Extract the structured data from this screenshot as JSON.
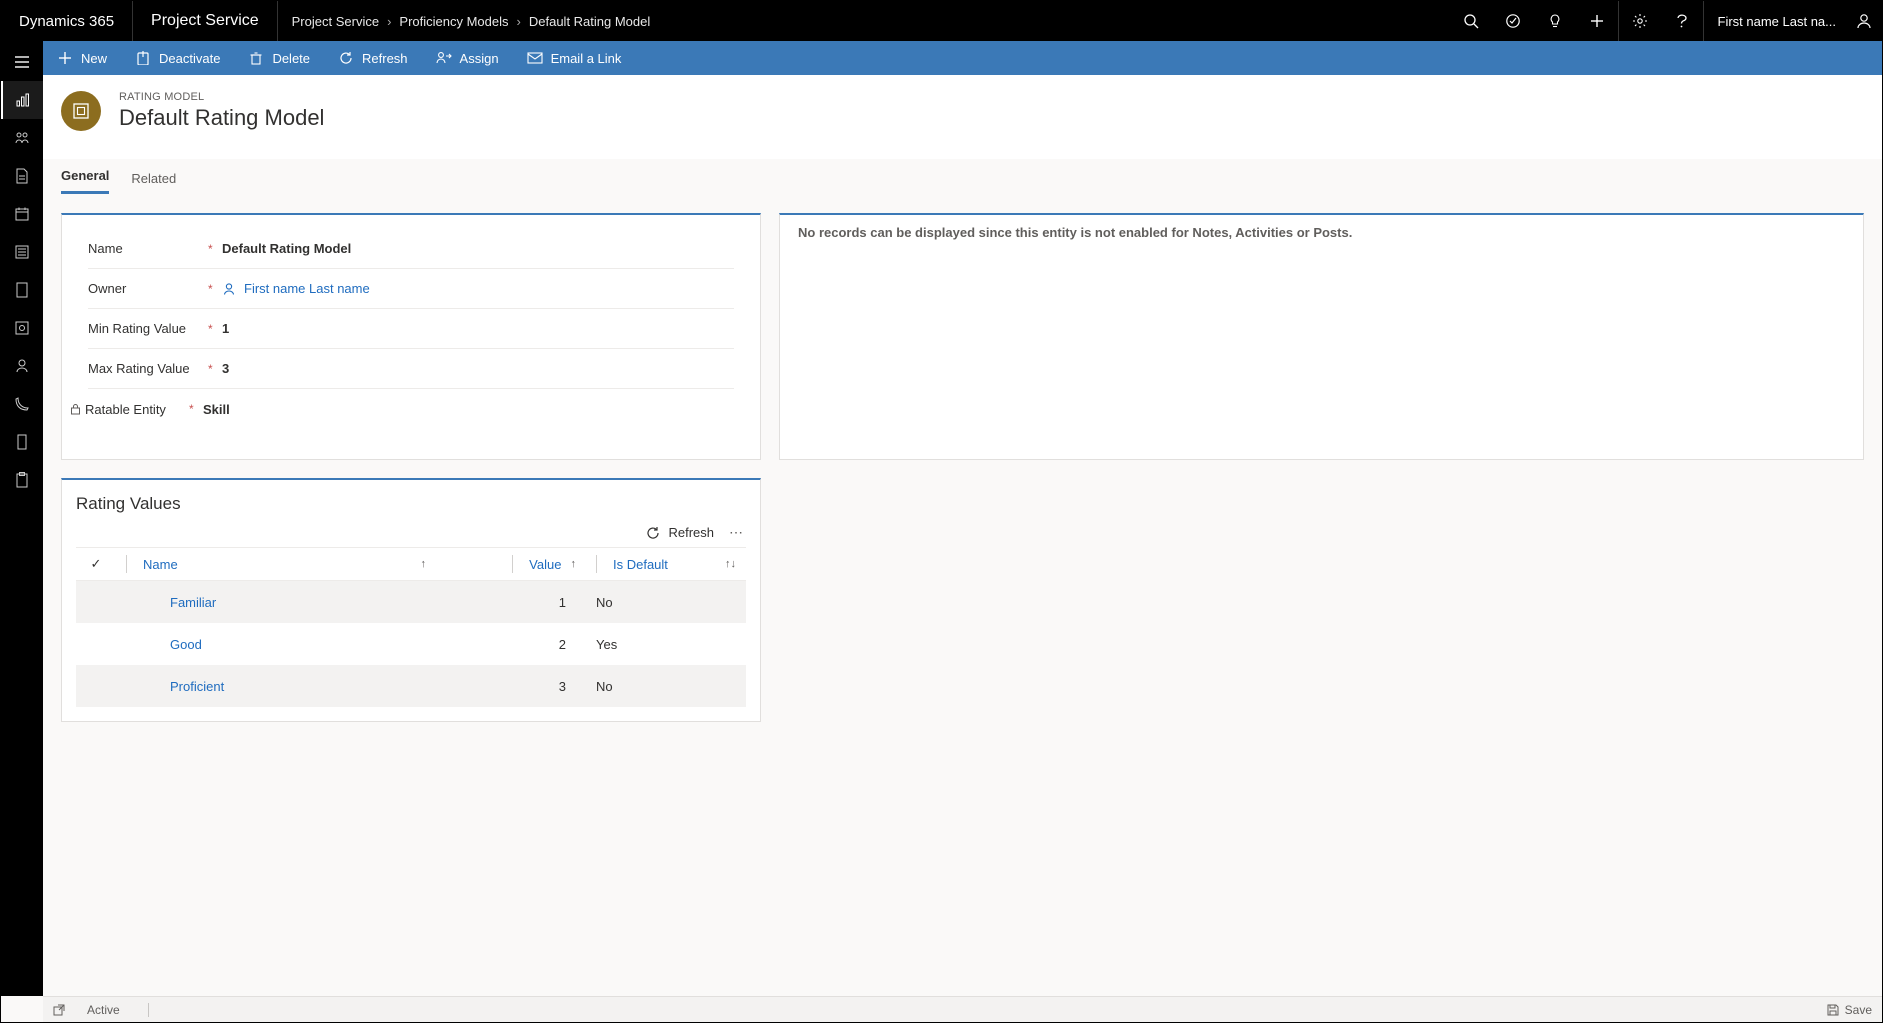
{
  "brand": "Dynamics 365",
  "product": "Project Service",
  "breadcrumb": [
    "Project Service",
    "Proficiency Models",
    "Default Rating Model"
  ],
  "user_display": "First name Last na...",
  "cmdbar": {
    "new": "New",
    "deactivate": "Deactivate",
    "delete": "Delete",
    "refresh": "Refresh",
    "assign": "Assign",
    "email": "Email a Link"
  },
  "record": {
    "entity_type": "RATING MODEL",
    "title": "Default Rating Model"
  },
  "tabs": {
    "general": "General",
    "related": "Related"
  },
  "form": {
    "labels": {
      "name": "Name",
      "owner": "Owner",
      "min": "Min Rating Value",
      "max": "Max Rating Value",
      "ratable": "Ratable Entity"
    },
    "values": {
      "name": "Default Rating Model",
      "owner": "First name Last name",
      "min": "1",
      "max": "3",
      "ratable": "Skill"
    }
  },
  "notes_empty": "No records can be displayed since this entity is not enabled for Notes, Activities or Posts.",
  "rating_values": {
    "section_title": "Rating Values",
    "refresh_label": "Refresh",
    "cols": {
      "name": "Name",
      "value": "Value",
      "isdefault": "Is Default"
    },
    "rows": [
      {
        "name": "Familiar",
        "value": "1",
        "isdefault": "No"
      },
      {
        "name": "Good",
        "value": "2",
        "isdefault": "Yes"
      },
      {
        "name": "Proficient",
        "value": "3",
        "isdefault": "No"
      }
    ]
  },
  "statusbar": {
    "status": "Active",
    "save": "Save"
  }
}
